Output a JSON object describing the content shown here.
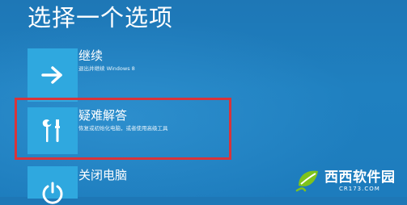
{
  "page": {
    "title": "选择一个选项"
  },
  "options": [
    {
      "label": "继续",
      "description": "退出并继续 Windows 8",
      "icon": "arrow-right-icon"
    },
    {
      "label": "疑难解答",
      "description": "恢复或初始化电脑，或者使用高级工具",
      "icon": "tools-icon",
      "highlighted": true
    },
    {
      "label": "关闭电脑",
      "icon": "power-icon"
    }
  ],
  "watermark": {
    "text": "西西软件园",
    "domain": "CR173.COM",
    "icon": "leaf-logo-icon"
  },
  "colors": {
    "background": "#1e77b6",
    "tile": "#2fa8df",
    "highlight_border": "#d8343a",
    "watermark_green": "#7fc31c"
  }
}
